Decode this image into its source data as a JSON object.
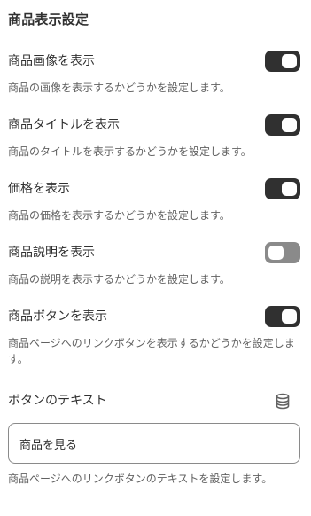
{
  "section": {
    "title": "商品表示設定"
  },
  "settings": [
    {
      "label": "商品画像を表示",
      "help": "商品の画像を表示するかどうかを設定します。",
      "enabled": true
    },
    {
      "label": "商品タイトルを表示",
      "help": "商品のタイトルを表示するかどうかを設定します。",
      "enabled": true
    },
    {
      "label": "価格を表示",
      "help": "商品の価格を表示するかどうかを設定します。",
      "enabled": true
    },
    {
      "label": "商品説明を表示",
      "help": "商品の説明を表示するかどうかを設定します。",
      "enabled": false
    },
    {
      "label": "商品ボタンを表示",
      "help": "商品ページへのリンクボタンを表示するかどうかを設定します。",
      "enabled": true
    }
  ],
  "button_text_field": {
    "label": "ボタンのテキスト",
    "icon": "database-icon",
    "value": "商品を見る",
    "help": "商品ページへのリンクボタンのテキストを設定します。"
  },
  "colors": {
    "toggle_on": "#303030",
    "toggle_off": "#8a8a8a",
    "text_primary": "#303030",
    "text_secondary": "#616161"
  }
}
